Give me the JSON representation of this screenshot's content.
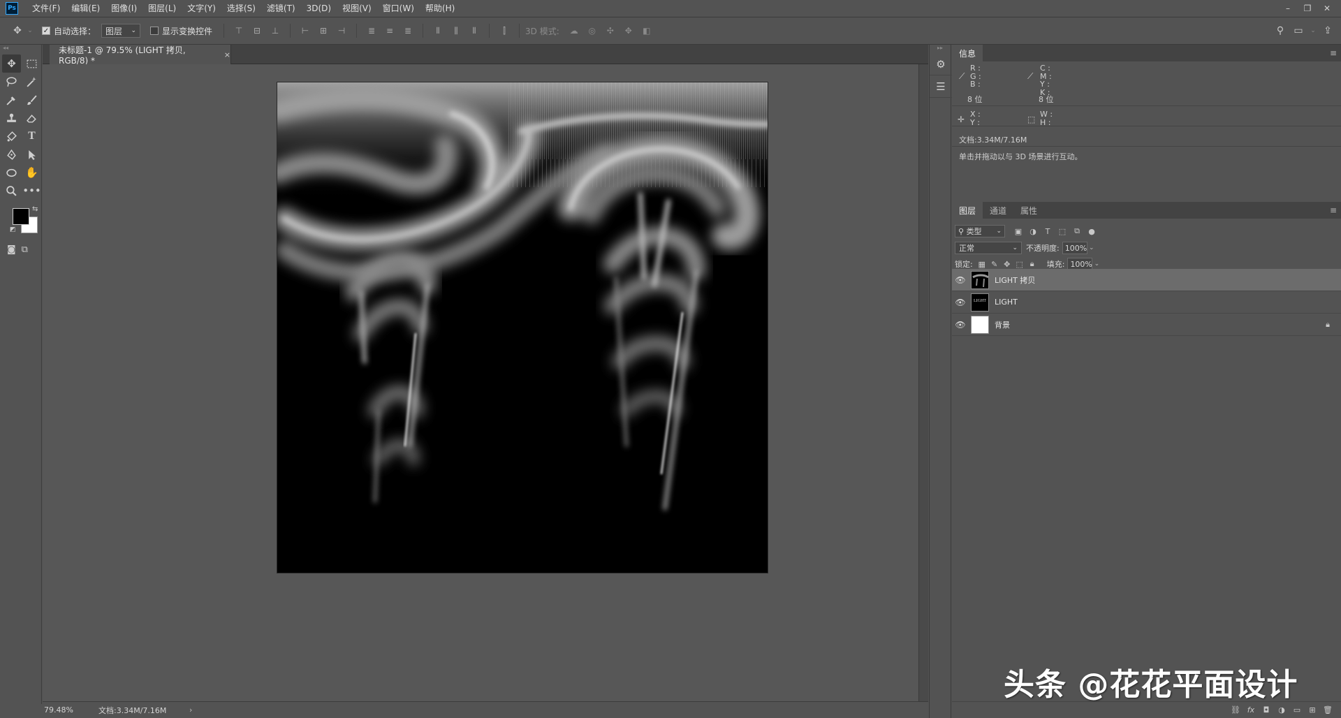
{
  "app": {
    "logo": "Ps"
  },
  "menu": [
    "文件(F)",
    "编辑(E)",
    "图像(I)",
    "图层(L)",
    "文字(Y)",
    "选择(S)",
    "滤镜(T)",
    "3D(D)",
    "视图(V)",
    "窗口(W)",
    "帮助(H)"
  ],
  "options": {
    "auto_select_label": "自动选择：",
    "auto_select_value": "图层",
    "transform_label": "显示变换控件",
    "mode_3d_label": "3D 模式:"
  },
  "document": {
    "tab_title": "未标题-1 @ 79.5% (LIGHT 拷贝, RGB/8) *",
    "close_glyph": "×"
  },
  "status": {
    "zoom": "79.48%",
    "doc_info": "文档:3.34M/7.16M",
    "arrow": "›"
  },
  "info_panel": {
    "tab": "信息",
    "rgb_labels": [
      "R :",
      "G :",
      "B :"
    ],
    "cmyk_labels": [
      "C :",
      "M :",
      "Y :",
      "K :"
    ],
    "bits_left": "8 位",
    "bits_right": "8 位",
    "xy_labels": [
      "X :",
      "Y :"
    ],
    "wh_labels": [
      "W :",
      "H :"
    ],
    "doc": "文档:3.34M/7.16M",
    "hint": "单击并拖动以与 3D 场景进行互动。"
  },
  "layers_panel": {
    "tabs": [
      "图层",
      "通道",
      "属性"
    ],
    "kind_label": "类型",
    "blend_mode": "正常",
    "opacity_label": "不透明度:",
    "opacity_value": "100%",
    "lock_label": "锁定:",
    "fill_label": "填充:",
    "fill_value": "100%",
    "layers": [
      {
        "name": "LIGHT 拷贝",
        "selected": true
      },
      {
        "name": "LIGHT",
        "selected": false
      },
      {
        "name": "背景",
        "selected": false,
        "locked": true
      }
    ],
    "thumb_text": "LIGHT"
  },
  "watermark": "头条 @花花平面设计",
  "colors": {
    "ui_bg": "#535353",
    "canvas_bg": "#000000",
    "selected_layer": "#6c6c6c",
    "accent": "#31a8ff"
  }
}
